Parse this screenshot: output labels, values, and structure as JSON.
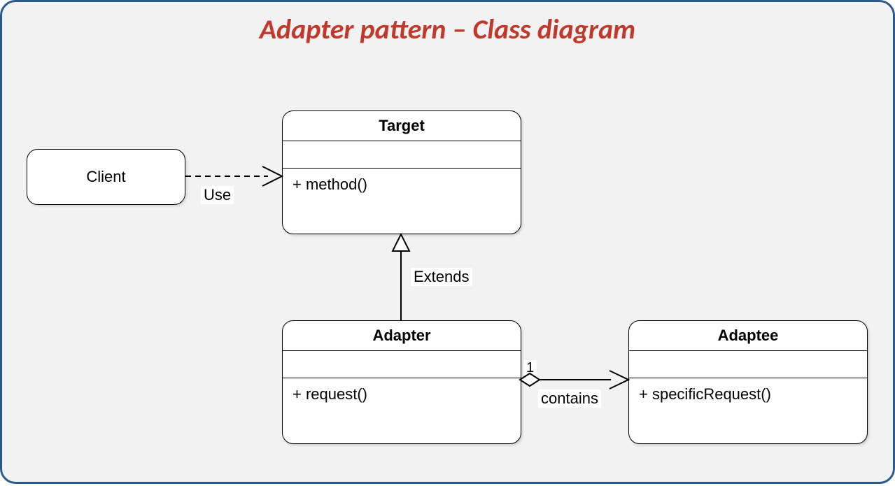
{
  "title": "Adapter pattern – Class diagram",
  "colors": {
    "border": "#2b5a8a",
    "title": "#c0392b"
  },
  "client": {
    "name": "Client"
  },
  "target": {
    "name": "Target",
    "method": "+ method()"
  },
  "adapter": {
    "name": "Adapter",
    "method": "+ request()"
  },
  "adaptee": {
    "name": "Adaptee",
    "method": "+ specificRequest()"
  },
  "rel": {
    "client_target": {
      "label": "Use",
      "style": "dependency"
    },
    "adapter_target": {
      "label": "Extends",
      "style": "generalization"
    },
    "adapter_adaptee": {
      "label": "contains",
      "multiplicity": "1",
      "style": "aggregation-with-arrow"
    }
  }
}
